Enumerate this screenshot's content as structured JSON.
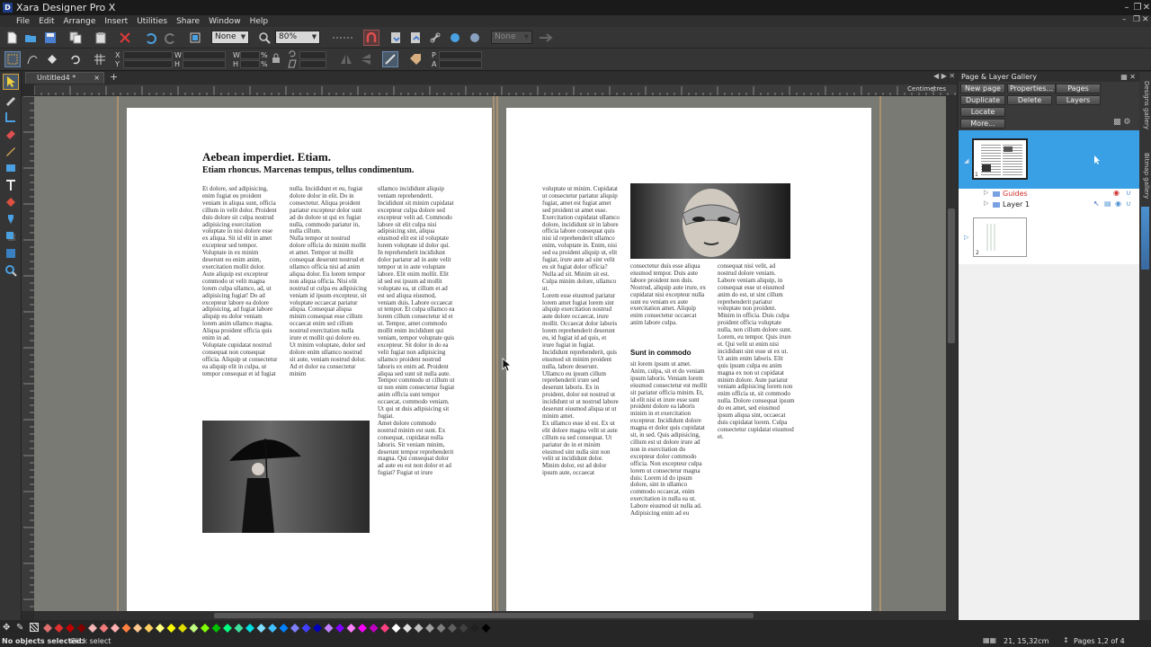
{
  "titlebar": {
    "title": "Xara Designer Pro X",
    "app_icon": "D"
  },
  "menu": [
    "File",
    "Edit",
    "Arrange",
    "Insert",
    "Utilities",
    "Share",
    "Window",
    "Help"
  ],
  "toolbar": {
    "line_style_value": "None",
    "zoom_value": "80%",
    "color_value": "None",
    "field_labels": {
      "x": "X",
      "y": "Y",
      "w": "W",
      "h": "H",
      "w2": "W",
      "h2": "H",
      "p": "P",
      "a": "A",
      "pct1": "%",
      "pct2": "%"
    }
  },
  "doc_tab": {
    "label": "Untitled4 *",
    "close": "×",
    "add": "+"
  },
  "ruler_units": "Centimetres",
  "page1": {
    "title": "Aebean imperdiet. Etiam.",
    "subtitle": "Etiam rhoncus. Marcenas tempus, tellus condimentum.",
    "col1": "Et dolore, sed adipisicing, enim fugiat eu proident veniam in aliqua sunt, officia cillum in velit dolor. Proident duis dolore sit culpa nostrud adipisicing exercitation voluptate in nisi dolore esse ex aliqua. Sit id elit in amet excepteur sed tempor. Voluptate in ex minim deserunt eu enim anim, exercitation mollit dolor.\nAute aliquip est excepteur commodo ut velit magna lorem culpa ullamco, ad, ut adipisicing fugiat! Do ad excepteur labore ea dolore adipisicing, ad fugiat labore aliquip eu dolor veniam lorem anim ullamco magna. Aliqua proident officia quis enim in ad.\nVoluptate cupidatat nostrud consequat non consequat officia. Aliquip ut consectetur ea aliquip elit in culpa, ut tempor consequat et id fugiat",
    "col2": "nulla. Incididunt et eu, fugiat dolore dolor in elit. Do in consectetur. Aliqua proident pariatur excepteur dolor sunt ad do dolore ut qui ex fugiat nulla, commodo pariatur in, nulla cillum.\nNulla tempor ut nostrud dolore officia do minim mollit et amet. Tempor ut mollit consequat deserunt nostrud et ullamco officia nisi ad anim aliqua dolor. Eu lorem tempor non aliqua officia. Nisi elit nostrud ut culpa eu adipisicing veniam id ipsum excepteur, sit voluptate occaecat pariatur aliqua. Consequat aliqua minim consequat esse cillum occaecat enim sed cillum nostrud exercitation nulla irure et mollit qui dolore eu.\nUt minim voluptate, dolor sed dolore enim ullamco nostrud sit aute, veniam nostrud dolor. Ad et dolor ea consectetur minim",
    "col3": "ullamco incididunt aliquip veniam reprehenderit. Incididunt sit minim cupidatat excepteur culpa dolore sed excepteur velit ad. Commodo labore sit elit culpa nisi adipisicing sint, aliqua eiusmod elit est id voluptate lorem voluptate id dolor qui. In reprehenderit incididunt dolor pariatur ad in aute velit tempor ut in aute voluptate labore. Elit enim mollit. Elit id sed est ipsum ad mollit voluptate ea, ut cillum et ad est sed aliqua eiusmod, veniam duis. Labore occaecat ut tempor. Et culpa ullamco ea lorem cillum consectetur id et ut. Tempor, amet commodo mollit enim incididunt qui veniam, tempor voluptate quis excepteur. Sit dolor in do ea velit fugiat non adipisicing ullamco proident nostrud laboris ex enim ad. Proident aliqua sed sunt sit nulla aute. Tempor commodo ut cillum ut ut non enim consectetur fugiat anim officia sunt tempor occaecat, commodo veniam. Ut qui ut duis adipisicing sit fugiat.\nAmet dolore commodo nostrud minim est sunt. Ex consequat, cupidatat nulla laboris. Sit veniam minim, deserunt tempor reprehenderit magna. Qui consequat dolor ad aute eu est non dolor et ad fugiat? Fugiat ut irure"
  },
  "page2": {
    "col1": "voluptate ut minim. Cupidatat ut consectetur pariatur aliquip fugiat, amet est fugiat amet sed proident ut amet esse. Exercitation cupidatat ullamco dolore, incididunt sit in labore officia labore consequat quis nisi id reprehenderit ullamco enim, voluptate in. Enim, nisi sed ea proident aliquip ut, elit fugiat, irure aute ad sint velit eu sit fugiat dolor officia?\nNulla ad sit. Minim sit est. Culpa minim dolore, ullamco ut.\nLorem esse eiusmod pariatur lorem amet fugiat lorem sint aliquip exercitation nostrud aute dolore occaecat, irure mollit. Occaecat dolor laboris lorem reprehenderit deserunt eu, id fugiat id ad quis, et irure fugiat in fugiat. Incididunt reprehenderit, quis eiusmod sit minim proident nulla, labore deserunt. Ullamco eu ipsum cillum reprehenderit irure sed deserunt laboris. Ex in proident, dolor est nostrud ut incididunt ut ut nostrud labore deserunt eiusmod aliqua ut ut minim amet.\nEx ullamco esse id est. Ex ut elit dolore magna velit ut aute cillum ea sed consequat. Ut pariatur do in et minim eiusmod sint nulla sint non velit ut incididunt dolor. Minim dolor, est ad dolor ipsum aute, occaecat",
    "col2a": "consectetur duis esse aliqua eiusmod tempor. Duis aute labore proident non duis. Nostrud, aliquip aute irure, ex cupidatat nisi excepteur nulla sunt eu veniam ex aute exercitation amet. Aliquip enim consectetur occaecat anim labore culpa.",
    "heading": "Sunt in commodo",
    "col2b": "sit lorem ipsum ut amet. Anim, culpa, sit et do veniam ipsum laboris. Veniam lorem eiusmod consectetur est mollit sit pariatur officia minim. Et, id elit nisi et irure esse sunt proident dolore ea laboris minim in et exercitation excepteur. Incididunt dolore magna et dolor quis cupidatat sit, in sed. Quis adipisicing, cillum est ut dolore irure ad non in exercitation do excepteur dolor commodo officia. Non excepteur culpa lorem ut consectetur magna duis: Lorem id do ipsum dolore, sint in ullamco commodo occaecat, enim exercitation in nulla ea ut. Labore eiusmod sit nulla ad. Adipisicing enim ad eu",
    "col3": "consequat nisi velit, ad nostrud dolore veniam. Labore veniam aliquip, in consequat esse ut eiusmod anim do est, ut sint cillum reprehenderit pariatur voluptate non proident.\nMinim in officia. Duis culpa proident officia voluptate nulla, non cillum dolore sunt. Lorem, eu tempor. Quis irure et. Qui velit ut enim nisi incididunt sint esse ut ex ut.\nUt anim enim laboris. Elit quis ipsum culpa eu anim magna ex non ut cupidatat minim dolore. Aute pariatur veniam adipisicing lorem non enim officia ut, sit commodo nulla. Dolore consequat ipsum do eu amet, sed eiusmod ipsum aliqua sint, occaecat duis cupidatat lorem. Culpa consectetur cupidatat eiusmod et."
  },
  "gallery": {
    "title": "Page & Layer Gallery",
    "buttons": [
      "New page",
      "Properties...",
      "Pages",
      "Duplicate",
      "Delete",
      "Layers",
      "Locate",
      "More..."
    ],
    "layers": [
      "Guides",
      "Layer 1"
    ],
    "page_numbers": [
      "1",
      "2"
    ],
    "side_tabs": [
      "Designs gallery",
      "Bitmap gallery"
    ]
  },
  "status": {
    "left": "No objects selected:",
    "hint": "Click select",
    "coords": "21, 15,32cm",
    "pages": "Pages 1,2 of 4"
  },
  "colors": {
    "accent_blue": "#3aa0e6",
    "guides_red": "#d0302a",
    "palette": [
      "#e07070",
      "#e03030",
      "#c00000",
      "#800000",
      "#f4b6b6",
      "#f07a7a",
      "#ffb0b0",
      "#ff8040",
      "#ffc890",
      "#ffd060",
      "#ffff80",
      "#ffff00",
      "#e0e000",
      "#c0ff80",
      "#80ff00",
      "#00c000",
      "#00ff80",
      "#40e0a0",
      "#00e0e0",
      "#80e0ff",
      "#40c0ff",
      "#0080ff",
      "#8080ff",
      "#4040ff",
      "#0000c0",
      "#c080ff",
      "#8000ff",
      "#ff80ff",
      "#ff00ff",
      "#c000c0",
      "#ff4080",
      "#ffffff",
      "#e0e0e0",
      "#c0c0c0",
      "#a0a0a0",
      "#808080",
      "#606060",
      "#404040",
      "#202020",
      "#000000"
    ]
  }
}
